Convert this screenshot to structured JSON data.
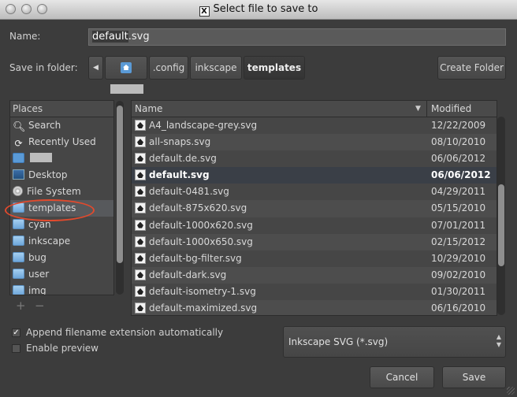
{
  "window": {
    "title": "Select file to save to"
  },
  "name_row": {
    "label": "Name:",
    "value_selected": "default",
    "value_rest": ".svg"
  },
  "folder_row": {
    "label": "Save in folder:",
    "crumbs": [
      ".config",
      "inkscape",
      "templates"
    ],
    "create_folder": "Create Folder"
  },
  "places": {
    "header": "Places",
    "items": [
      {
        "label": "Search",
        "icon": "search-icon"
      },
      {
        "label": "Recently Used",
        "icon": "recent-icon"
      },
      {
        "label": "",
        "icon": "home-folder-icon"
      },
      {
        "label": "Desktop",
        "icon": "desktop-icon"
      },
      {
        "label": "File System",
        "icon": "filesystem-icon"
      },
      {
        "label": "templates",
        "icon": "folder-icon"
      },
      {
        "label": "cyan",
        "icon": "folder-icon"
      },
      {
        "label": "inkscape",
        "icon": "folder-icon"
      },
      {
        "label": "bug",
        "icon": "folder-icon"
      },
      {
        "label": "user",
        "icon": "folder-icon"
      },
      {
        "label": "img",
        "icon": "folder-icon"
      }
    ],
    "add": "+",
    "remove": "−"
  },
  "files": {
    "col_name": "Name",
    "col_modified": "Modified",
    "rows": [
      {
        "name": "A4_landscape-grey.svg",
        "date": "12/22/2009"
      },
      {
        "name": "all-snaps.svg",
        "date": "08/10/2010"
      },
      {
        "name": "default.de.svg",
        "date": "06/06/2012"
      },
      {
        "name": "default.svg",
        "date": "06/06/2012"
      },
      {
        "name": "default-0481.svg",
        "date": "04/29/2011"
      },
      {
        "name": "default-875x620.svg",
        "date": "05/15/2010"
      },
      {
        "name": "default-1000x620.svg",
        "date": "07/01/2011"
      },
      {
        "name": "default-1000x650.svg",
        "date": "02/15/2012"
      },
      {
        "name": "default-bg-filter.svg",
        "date": "10/29/2010"
      },
      {
        "name": "default-dark.svg",
        "date": "09/02/2010"
      },
      {
        "name": "default-isometry-1.svg",
        "date": "01/30/2011"
      },
      {
        "name": "default-maximized.svg",
        "date": "06/16/2010"
      }
    ]
  },
  "options": {
    "append_ext": "Append filename extension automatically",
    "append_checked": "✓",
    "preview": "Enable preview"
  },
  "filetype": {
    "value": "Inkscape SVG (*.svg)"
  },
  "buttons": {
    "cancel": "Cancel",
    "save": "Save"
  }
}
